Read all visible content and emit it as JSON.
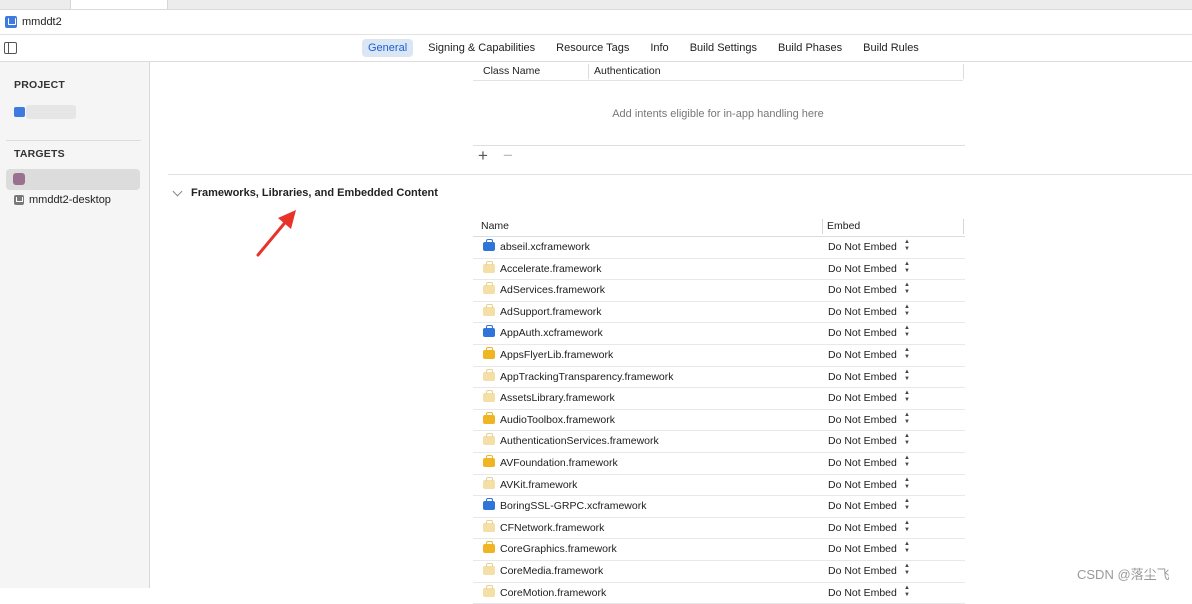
{
  "breadcrumb": {
    "project_name": "mmddt2"
  },
  "tabs": [
    {
      "label": "General",
      "active": true
    },
    {
      "label": "Signing & Capabilities",
      "active": false
    },
    {
      "label": "Resource Tags",
      "active": false
    },
    {
      "label": "Info",
      "active": false
    },
    {
      "label": "Build Settings",
      "active": false
    },
    {
      "label": "Build Phases",
      "active": false
    },
    {
      "label": "Build Rules",
      "active": false
    }
  ],
  "sidebar": {
    "project_header": "PROJECT",
    "targets_header": "TARGETS",
    "targets": [
      {
        "label": "mmddt2-desktop"
      }
    ]
  },
  "intents": {
    "col_class_name": "Class Name",
    "col_authentication": "Authentication",
    "placeholder": "Add intents eligible for in-app handling here",
    "add_symbol": "+",
    "remove_symbol": "−"
  },
  "frameworks": {
    "section_title": "Frameworks, Libraries, and Embedded Content",
    "col_name": "Name",
    "col_embed": "Embed",
    "rows": [
      {
        "name": "abseil.xcframework",
        "embed": "Do Not Embed",
        "icon": "blue"
      },
      {
        "name": "Accelerate.framework",
        "embed": "Do Not Embed",
        "icon": "pale"
      },
      {
        "name": "AdServices.framework",
        "embed": "Do Not Embed",
        "icon": "pale"
      },
      {
        "name": "AdSupport.framework",
        "embed": "Do Not Embed",
        "icon": "pale"
      },
      {
        "name": "AppAuth.xcframework",
        "embed": "Do Not Embed",
        "icon": "blue"
      },
      {
        "name": "AppsFlyerLib.framework",
        "embed": "Do Not Embed",
        "icon": "gold"
      },
      {
        "name": "AppTrackingTransparency.framework",
        "embed": "Do Not Embed",
        "icon": "pale"
      },
      {
        "name": "AssetsLibrary.framework",
        "embed": "Do Not Embed",
        "icon": "pale"
      },
      {
        "name": "AudioToolbox.framework",
        "embed": "Do Not Embed",
        "icon": "gold"
      },
      {
        "name": "AuthenticationServices.framework",
        "embed": "Do Not Embed",
        "icon": "pale"
      },
      {
        "name": "AVFoundation.framework",
        "embed": "Do Not Embed",
        "icon": "gold"
      },
      {
        "name": "AVKit.framework",
        "embed": "Do Not Embed",
        "icon": "pale"
      },
      {
        "name": "BoringSSL-GRPC.xcframework",
        "embed": "Do Not Embed",
        "icon": "blue"
      },
      {
        "name": "CFNetwork.framework",
        "embed": "Do Not Embed",
        "icon": "pale"
      },
      {
        "name": "CoreGraphics.framework",
        "embed": "Do Not Embed",
        "icon": "gold"
      },
      {
        "name": "CoreMedia.framework",
        "embed": "Do Not Embed",
        "icon": "pale"
      },
      {
        "name": "CoreMotion.framework",
        "embed": "Do Not Embed",
        "icon": "pale"
      }
    ]
  },
  "watermark": "CSDN @落尘飞",
  "colors": {
    "accent": "#1a5fd0",
    "arrow": "#e8332b"
  }
}
